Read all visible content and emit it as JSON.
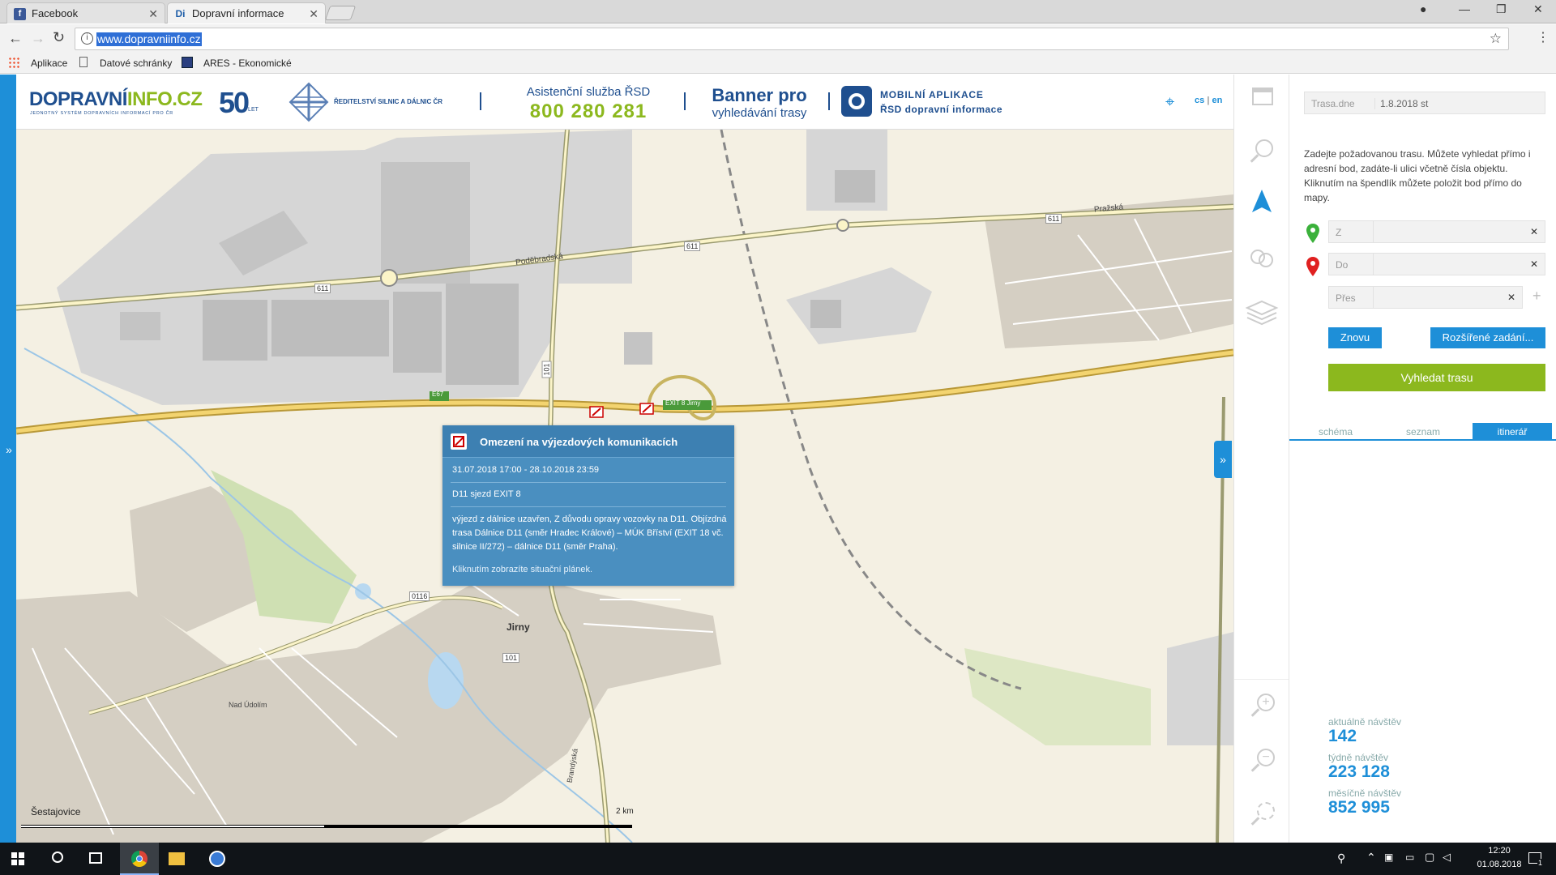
{
  "browser": {
    "tabs": [
      {
        "label": "Facebook",
        "icon": "facebook-icon"
      },
      {
        "label": "Dopravní informace",
        "icon": "dopravni-favicon"
      }
    ],
    "url": "www.dopravniinfo.cz",
    "bookmarks": [
      "Aplikace",
      "Datové schránky",
      "ARES - Ekonomické"
    ]
  },
  "header": {
    "logo_main": "DOPRAVNÍ",
    "logo_domain": "INFO.CZ",
    "logo_sub": "JEDNOTNÝ SYSTÉM DOPRAVNÍCH INFORMACÍ PRO ČR",
    "years_number": "50",
    "years_label": "LET",
    "rsd_text": "ŘEDITELSTVÍ SILNIC A DÁLNIC ČR",
    "assist_title": "Asistenční služba ŘSD",
    "assist_phone": "800 280 281",
    "banner_title": "Banner pro",
    "banner_sub": "vyhledávání trasy",
    "app_title": "MOBILNÍ APLIKACE",
    "app_sub": "ŘSD dopravní informace",
    "lang_cs": "cs",
    "lang_sep": "|",
    "lang_en": "en"
  },
  "map": {
    "labels": {
      "podebradska": "Poděbradská",
      "prazska": "Pražská",
      "road_611": "611",
      "road_101": "101",
      "road_0116": "0116",
      "road_e67": "E67",
      "exit": "EXIT 8 Jirny",
      "jirny": "Jirny",
      "nad_udolim": "Nad Údolím",
      "brandyska": "Brandýská",
      "sestajovice": "Šestajovice"
    },
    "scale_label": "2 km"
  },
  "popup": {
    "title": "Omezení na výjezdových komunikacích",
    "date_range": "31.07.2018 17:00 - 28.10.2018 23:59",
    "location": "D11 sjezd EXIT 8",
    "description": "výjezd z dálnice uzavřen, Z důvodu opravy vozovky na D11. Objízdná trasa Dálnice D11 (směr Hradec Králové) – MÚK Bříství (EXIT 18 vč. silnice II/272) – dálnice D11 (směr Praha).",
    "link": "Kliknutím zobrazíte situační plánek."
  },
  "panel": {
    "date_label": "Trasa.dne",
    "date_value": "1.8.2018 st",
    "intro": "Zadejte požadovanou trasu. Můžete vyhledat přímo i adresní bod, zadáte-li ulici včetně čísla objektu. Kliknutím na špendlík můžete položit bod přímo do mapy.",
    "from_label": "Z",
    "to_label": "Do",
    "via_label": "Přes",
    "again_button": "Znovu",
    "advanced_button": "Rozšířené zadání...",
    "search_button": "Vyhledat trasu",
    "tabs": [
      "schéma",
      "seznam",
      "itinerář"
    ],
    "stats": [
      {
        "label": "aktuálně návštěv",
        "value": "142"
      },
      {
        "label": "týdně návštěv",
        "value": "223 128"
      },
      {
        "label": "měsíčně návštěv",
        "value": "852 995"
      }
    ]
  },
  "taskbar": {
    "time": "12:20",
    "date": "01.08.2018",
    "notification_count": "1"
  },
  "colors": {
    "accent_blue": "#1e8fd8",
    "green_button": "#8cb81e",
    "popup_blue": "#4a8fc0",
    "phone_green": "#8cb81e"
  }
}
